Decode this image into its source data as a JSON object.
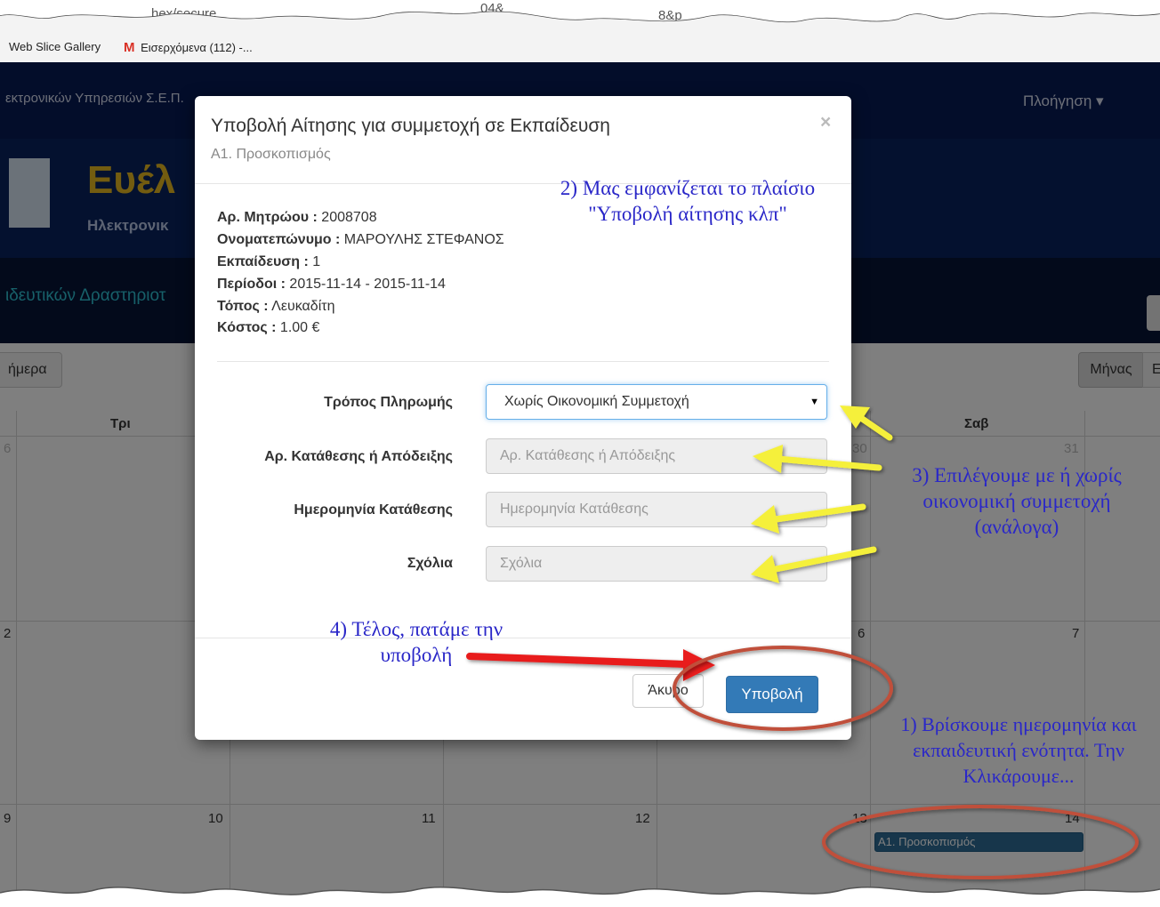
{
  "browser": {
    "url_fragments": [
      "hex/secure",
      "04&",
      "8&p"
    ],
    "bookmarks": [
      "Web Slice Gallery",
      "Εισερχόμενα (112) -..."
    ],
    "gmail_icon": "gmail-m-icon"
  },
  "site": {
    "brand": "εκτρονικών Υπηρεσιών Σ.Ε.Π.",
    "nav_label": "Πλοήγηση ▾",
    "hero_title": "Ευέλ",
    "hero_subtitle": "Ηλεκτρονικ",
    "subnav_title": "ιδευτικών Δραστηριοτ"
  },
  "calendar": {
    "today_btn": "ήμερα",
    "month_btn": "Μήνας",
    "week_btn": "Ε",
    "col_headers": [
      "Τρι",
      "Σαβ"
    ],
    "row1": [
      "6",
      "30",
      "31"
    ],
    "row2": [
      "2",
      "6",
      "7"
    ],
    "row3": [
      "9",
      "10",
      "11",
      "12",
      "13",
      "14"
    ],
    "event": "Α1. Προσκοπισμός"
  },
  "modal": {
    "title": "Υποβολή Αίτησης για συμμετοχή σε Εκπαίδευση",
    "subtitle": "Α1. Προσκοπισμός",
    "close": "×",
    "info": [
      {
        "label": "Αρ. Μητρώου :",
        "value": " 2008708"
      },
      {
        "label": "Ονοματεπώνυμο :",
        "value": " ΜΑΡΟΥΛΗΣ ΣΤΕΦΑΝΟΣ"
      },
      {
        "label": "Εκπαίδευση :",
        "value": " 1"
      },
      {
        "label": "Περίοδοι :",
        "value": " 2015-11-14 - 2015-11-14"
      },
      {
        "label": "Τόπος :",
        "value": " Λευκαδίτη"
      },
      {
        "label": "Κόστος :",
        "value": " 1.00 €"
      }
    ],
    "fields": {
      "payment_label": "Τρόπος Πληρωμής",
      "payment_value": "Χωρίς Οικονομική Συμμετοχή",
      "deposit_label": "Αρ. Κατάθεσης ή Απόδειξης",
      "deposit_placeholder": "Αρ. Κατάθεσης ή Απόδειξης",
      "date_label": "Ημερομηνία Κατάθεσης",
      "date_placeholder": "Ημερομηνία Κατάθεσης",
      "comments_label": "Σχόλια",
      "comments_placeholder": "Σχόλια"
    },
    "cancel": "Άκυρο",
    "submit": "Υποβολή"
  },
  "annotations": {
    "a1_l1": "1) Βρίσκουμε ημερομηνία και",
    "a1_l2": "εκπαιδευτική ενότητα. Την",
    "a1_l3": "Κλικάρουμε...",
    "a2_l1": "2) Μας εμφανίζεται το πλαίσιο",
    "a2_l2": "\"Υποβολή αίτησης κλπ\"",
    "a3_l1": "3) Επιλέγουμε με ή χωρίς",
    "a3_l2": "οικονομική συμμετοχή",
    "a3_l3": "(ανάλογα)",
    "a4_l1": "4) Τέλος, πατάμε την",
    "a4_l2": "υποβολή"
  },
  "colors": {
    "annotation_text": "#2a27c8",
    "yellow_arrow": "#f5f03a",
    "red_arrow": "#e81b1b",
    "circle": "#c0503a",
    "primary_button": "#337ab7"
  }
}
